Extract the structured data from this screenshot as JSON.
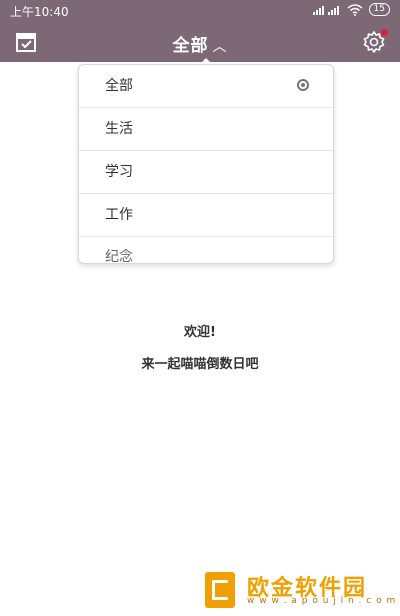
{
  "status_bar": {
    "time": "上午10:40",
    "battery": "15"
  },
  "header": {
    "title": "全部",
    "left_icon": "calendar-check-icon",
    "right_icon": "gear-icon",
    "notification_color": "#e0203a"
  },
  "dropdown": {
    "items": [
      {
        "label": "全部",
        "selected": true
      },
      {
        "label": "生活"
      },
      {
        "label": "学习"
      },
      {
        "label": "工作"
      },
      {
        "label": "纪念"
      }
    ]
  },
  "main": {
    "welcome": "欢迎!",
    "subtitle": "来一起喵喵倒数日吧"
  },
  "watermark": {
    "text": "欧金软件园",
    "url": "w w w . a p o u j i n . c o m"
  },
  "colors": {
    "header_bg": "#7d6876",
    "accent": "#f0a000"
  }
}
